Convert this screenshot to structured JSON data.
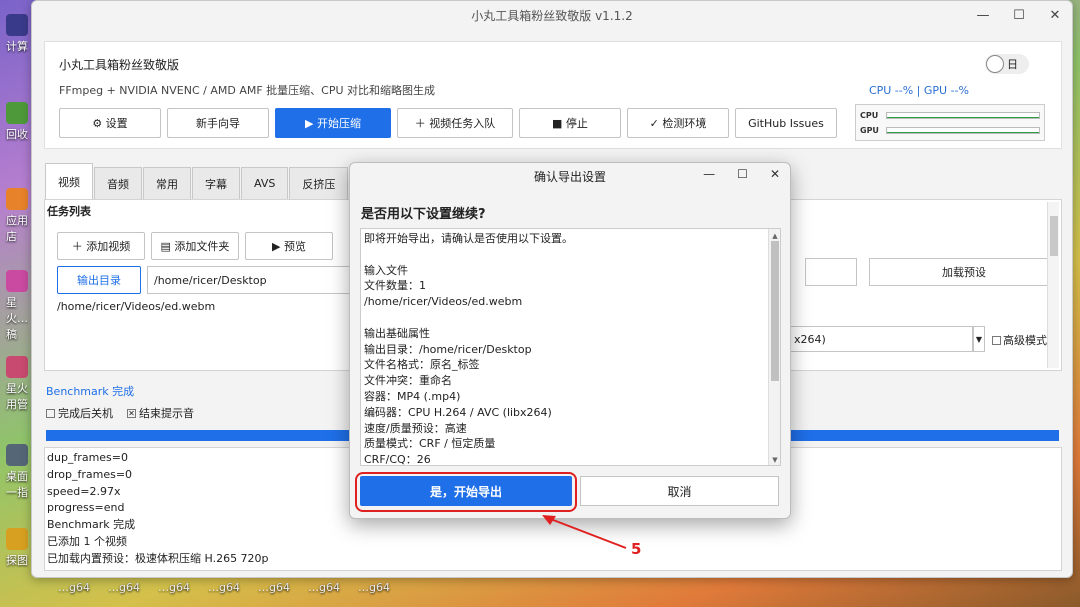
{
  "window": {
    "title": "小丸工具箱粉丝致敬版 v1.1.2",
    "minimize": "—",
    "maximize": "☐",
    "close": "✕"
  },
  "desktop": {
    "icons": [
      {
        "label": "计算",
        "color": "#3a3a8a"
      },
      {
        "label": "回收",
        "color": "#4e9a3a"
      },
      {
        "label": "应用店",
        "color": "#e8822a"
      },
      {
        "label": "星火…稿",
        "color": "#c94aa0"
      },
      {
        "label": "星火用管",
        "color": "#c94a70"
      },
      {
        "label": "桌面一指",
        "color": "#556677"
      },
      {
        "label": "探图",
        "color": "#d8a020"
      }
    ],
    "taskbar": [
      "…g64",
      "…g64",
      "…g64",
      "…g64",
      "…g64",
      "…g64",
      "…g64"
    ]
  },
  "header": {
    "app_name": "小丸工具箱粉丝致敬版",
    "subtitle": "FFmpeg + NVIDIA NVENC / AMD AMF 批量压缩、CPU 对比和缩略图生成",
    "theme_toggle": "日",
    "cpu_gpu_text": "CPU --% | GPU --%",
    "gauge_cpu": "CPU",
    "gauge_gpu": "GPU"
  },
  "toolbar": {
    "settings": "⚙ 设置",
    "wizard": "新手向导",
    "start": "▶ 开始压缩",
    "enqueue": "＋ 视频任务入队",
    "stop": "■ 停止",
    "check_env": "✓ 检测环境",
    "github": "GitHub Issues"
  },
  "tabs": [
    "视频",
    "音频",
    "常用",
    "字幕",
    "AVS",
    "反挤压"
  ],
  "task": {
    "title": "任务列表",
    "add_video": "＋ 添加视频",
    "add_folder": "▤ 添加文件夹",
    "preview": "▶ 预览",
    "output_dir_btn": "输出目录",
    "output_path": "/home/ricer/Desktop",
    "file": "/home/ricer/Videos/ed.webm",
    "load_preset": "加载预设",
    "encoder_partial": "x264)",
    "advanced": "高级模式"
  },
  "status": {
    "benchmark": "Benchmark 完成",
    "shutdown": "完成后关机",
    "sound": "结束提示音",
    "progress_pct": 100
  },
  "log": [
    "dup_frames=0",
    "drop_frames=0",
    "speed=2.97x",
    "progress=end",
    "Benchmark 完成",
    "已添加 1 个视频",
    "已加载内置预设：极速体积压缩 H.265 720p"
  ],
  "dialog": {
    "title": "确认导出设置",
    "question": "是否用以下设置继续?",
    "lines": [
      "即将开始导出，请确认是否使用以下设置。",
      "",
      "输入文件",
      "文件数量：1",
      "/home/ricer/Videos/ed.webm",
      "",
      "输出基础属性",
      "输出目录：/home/ricer/Desktop",
      "文件名格式：原名_标签",
      "文件冲突：重命名",
      "容器：MP4 (.mp4)",
      "编码器：CPU H.264 / AVC (libx264)",
      "速度/质量预设：高速",
      "质量模式：CRF / 恒定质量",
      "CRF/CQ：26"
    ],
    "confirm": "是，开始导出",
    "cancel": "取消"
  },
  "annotation": {
    "number": "5",
    "color": "#e02020"
  }
}
